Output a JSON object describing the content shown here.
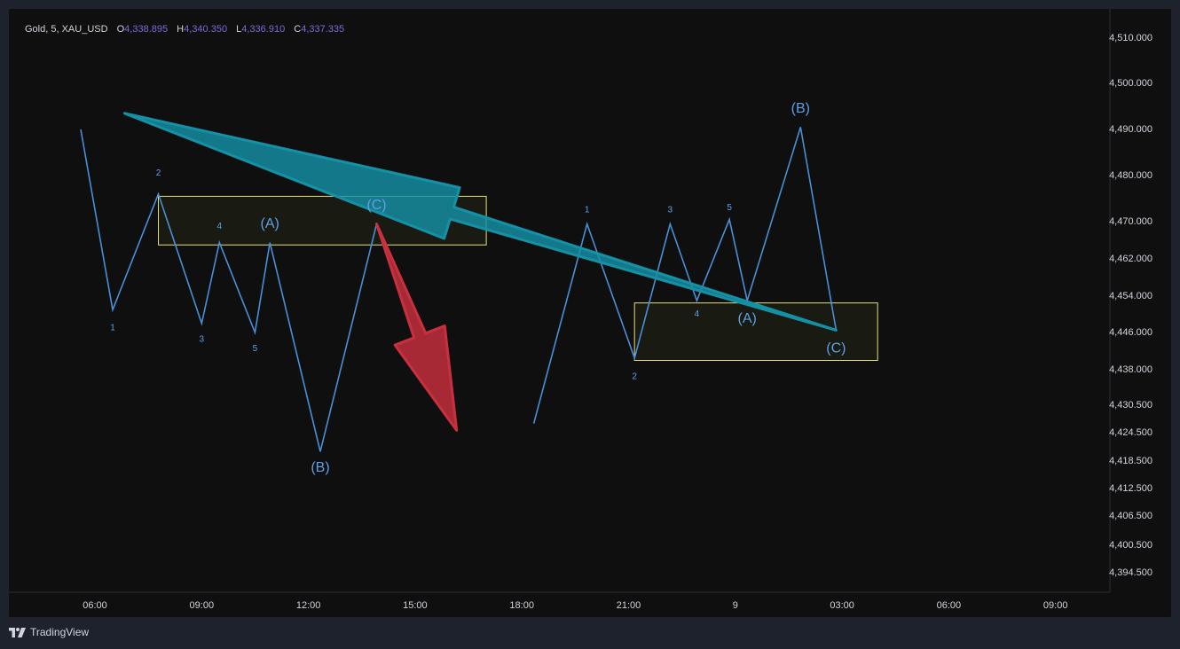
{
  "legend": {
    "symbol": "Gold, 5, XAU_USD",
    "open_key": "O",
    "open": "4,338.895",
    "high_key": "H",
    "high": "4,340.350",
    "low_key": "L",
    "low": "4,336.910",
    "close_key": "C",
    "close": "4,337.335"
  },
  "footer": {
    "brand": "TradingView",
    "logo_icon": "tradingview-logo-icon"
  },
  "chart_data": {
    "type": "line",
    "title": "",
    "y_ticks": [
      "4,510.000",
      "4,500.000",
      "4,490.000",
      "4,480.000",
      "4,470.000",
      "4,462.000",
      "4,454.000",
      "4,446.000",
      "4,438.000",
      "4,430.500",
      "4,424.500",
      "4,418.500",
      "4,412.500",
      "4,406.500",
      "4,400.500",
      "4,394.500"
    ],
    "x_ticks": [
      "06:00",
      "09:00",
      "12:00",
      "15:00",
      "18:00",
      "21:00",
      "9",
      "03:00",
      "06:00",
      "09:00"
    ],
    "series": [
      {
        "color": "#4a8fd6",
        "points": [
          {
            "x": "05:36",
            "y": 4490.0
          },
          {
            "x": "06:30",
            "y": 4451.0
          },
          {
            "x": "07:47",
            "y": 4476.0,
            "label": "2"
          },
          {
            "x": "09:00",
            "y": 4448.0
          },
          {
            "x": "09:30",
            "y": 4465.5
          },
          {
            "x": "10:30",
            "y": 4446.0
          },
          {
            "x": "10:55",
            "y": 4465.5
          },
          {
            "x": "12:20",
            "y": 4420.5
          },
          {
            "x": "13:55",
            "y": 4469.5
          }
        ]
      },
      {
        "color": "#4a8fd6",
        "points": [
          {
            "x": "18:20",
            "y": 4426.5
          },
          {
            "x": "19:50",
            "y": 4469.5
          },
          {
            "x": "21:10",
            "y": 4440.5
          },
          {
            "x": "22:10",
            "y": 4469.5
          },
          {
            "x": "22:55",
            "y": 4453.0
          },
          {
            "x": "23:50",
            "y": 4470.5
          },
          {
            "x": "00:20",
            "y": 4453.0
          },
          {
            "x": "01:50",
            "y": 4490.5
          },
          {
            "x": "02:50",
            "y": 4446.5
          }
        ]
      }
    ],
    "wave_labels": [
      {
        "text": "1",
        "x": "06:30",
        "y": 4447.0,
        "size": "small"
      },
      {
        "text": "2",
        "x": "07:47",
        "y": 4480.5,
        "size": "small"
      },
      {
        "text": "3",
        "x": "09:00",
        "y": 4444.5,
        "size": "small"
      },
      {
        "text": "4",
        "x": "09:30",
        "y": 4469.0,
        "size": "small"
      },
      {
        "text": "5",
        "x": "10:30",
        "y": 4442.5,
        "size": "small"
      },
      {
        "text": "(A)",
        "x": "10:55",
        "y": 4469.5,
        "size": "large"
      },
      {
        "text": "(B)",
        "x": "12:20",
        "y": 4417.0,
        "size": "large"
      },
      {
        "text": "(C)",
        "x": "13:55",
        "y": 4473.5,
        "size": "large"
      },
      {
        "text": "1",
        "x": "19:50",
        "y": 4472.5,
        "size": "small"
      },
      {
        "text": "2",
        "x": "21:10",
        "y": 4436.5,
        "size": "small"
      },
      {
        "text": "3",
        "x": "22:10",
        "y": 4472.5,
        "size": "small"
      },
      {
        "text": "4",
        "x": "22:55",
        "y": 4450.0,
        "size": "small"
      },
      {
        "text": "5",
        "x": "23:50",
        "y": 4473.0,
        "size": "small"
      },
      {
        "text": "(A)",
        "x": "00:20",
        "y": 4449.0,
        "size": "large"
      },
      {
        "text": "(B)",
        "x": "01:50",
        "y": 4494.5,
        "size": "large"
      },
      {
        "text": "(C)",
        "x": "02:50",
        "y": 4442.5,
        "size": "large"
      }
    ],
    "zones": [
      {
        "x_start": "07:47",
        "x_end": "17:00",
        "y_low": 4465.0,
        "y_high": 4475.5,
        "color": "#e8e07a"
      },
      {
        "x_start": "21:10",
        "x_end": "04:00",
        "y_low": 4440.0,
        "y_high": 4452.5,
        "color": "#e8e07a"
      }
    ],
    "arrows": [
      {
        "direction": "down",
        "color": "#c9303f",
        "from": {
          "x": "13:55",
          "y": 4469.5
        },
        "to": {
          "x": "16:10",
          "y": 4425.0
        }
      },
      {
        "direction": "up",
        "color": "#1591a6",
        "from": {
          "x": "02:50",
          "y": 4446.5
        },
        "to": {
          "x": "06:50",
          "y": 4493.5
        }
      }
    ],
    "grid": false,
    "legend_position": "top-left"
  },
  "colors": {
    "background": "#0f0f10",
    "page": "#1e222d",
    "axis_text": "#d1d4dc",
    "line": "#4a8fd6",
    "label": "#5ea0e6",
    "zone_border": "#e8e07a",
    "zone_fill": "#1b1c12",
    "down_arrow": "#c9303f",
    "up_arrow": "#1591a6"
  }
}
